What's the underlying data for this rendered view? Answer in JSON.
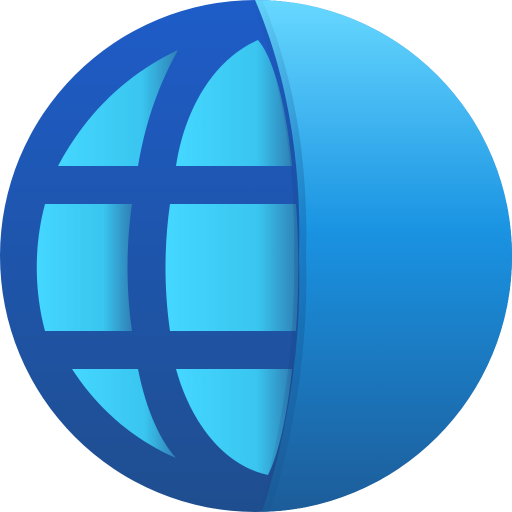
{
  "icon": {
    "name": "globe-icon",
    "style": "flat gradient globe, left half with grid lines, right half solid",
    "colors": {
      "frame_top": "#1E5CC8",
      "frame_bottom": "#1F4E8F",
      "cell_left": "#44D7FF",
      "cell_right": "#2F7FB5",
      "right_top": "#67D8FF",
      "right_mid": "#1A93E2",
      "right_bottom": "#1C5C99"
    }
  }
}
